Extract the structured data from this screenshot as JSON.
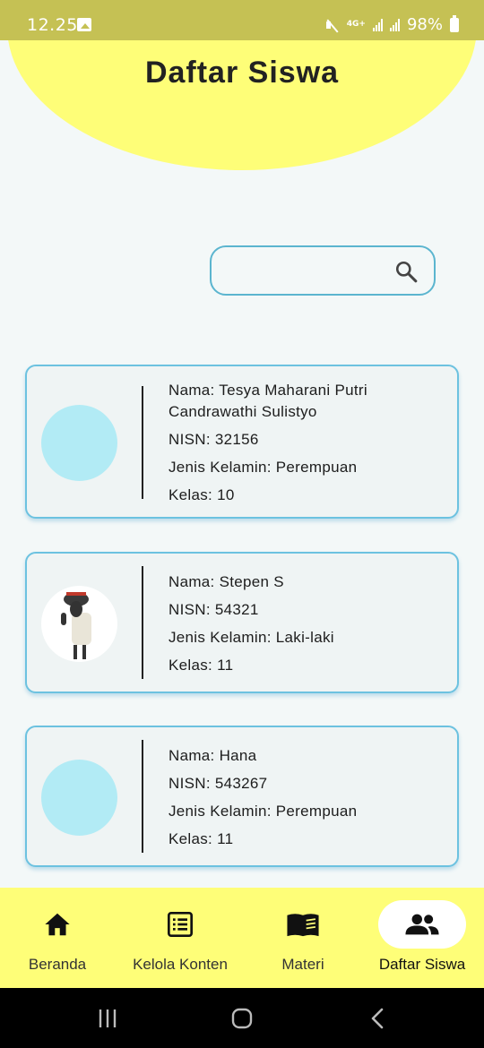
{
  "status_bar": {
    "time": "12.25",
    "network": "4G+",
    "battery": "98%",
    "left_icon": "image-notification-icon",
    "right_icons": [
      "mute-icon",
      "signal-icon",
      "battery-icon"
    ]
  },
  "header": {
    "title": "Daftar Siswa",
    "color": "#fefe78"
  },
  "search": {
    "value": "",
    "placeholder": "",
    "icon": "search-icon"
  },
  "students": [
    {
      "name_line": "Nama: Tesya Maharani Putri Candrawathi Sulistyo",
      "nisn_line": "NISN: 32156",
      "gender_line": "Jenis Kelamin: Perempuan",
      "class_line": "Kelas: 10",
      "avatar": "placeholder-avatar"
    },
    {
      "name_line": "Nama: Stepen S",
      "nisn_line": "NISN: 54321",
      "gender_line": "Jenis Kelamin: Laki-laki",
      "class_line": "Kelas: 11",
      "avatar": "sheep-character-photo"
    },
    {
      "name_line": "Nama: Hana",
      "nisn_line": "NISN: 543267",
      "gender_line": "Jenis Kelamin: Perempuan",
      "class_line": "Kelas: 11",
      "avatar": "placeholder-avatar"
    }
  ],
  "bottom_nav": {
    "items": [
      {
        "label": "Beranda",
        "icon": "home-icon",
        "active": false
      },
      {
        "label": "Kelola Konten",
        "icon": "list-icon",
        "active": false
      },
      {
        "label": "Materi",
        "icon": "book-icon",
        "active": false
      },
      {
        "label": "Daftar Siswa",
        "icon": "people-icon",
        "active": true
      }
    ]
  },
  "system_nav": [
    "recent-apps-icon",
    "home-button-icon",
    "back-icon"
  ],
  "colors": {
    "accent_yellow": "#fefe78",
    "card_border": "#6cc2e0",
    "avatar_placeholder": "#b2ebf5",
    "status_bar": "#c5c154"
  }
}
